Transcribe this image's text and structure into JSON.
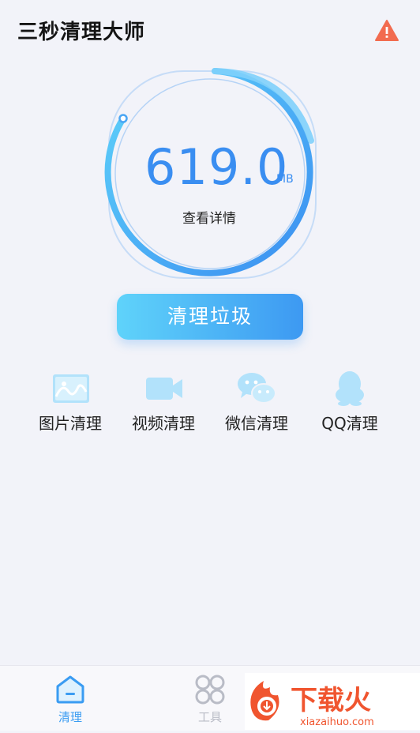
{
  "header": {
    "title": "三秒清理大师",
    "warning_icon": "warning-triangle-icon",
    "warning_color": "#f26b4f"
  },
  "gauge": {
    "value": "619.0",
    "unit": "MB",
    "detail_label": "查看详情",
    "arc_color_start": "#5fd3fa",
    "arc_color_end": "#3a8ef1"
  },
  "primary_action": {
    "label": "清理垃圾"
  },
  "features": [
    {
      "label": "图片清理",
      "icon": "image-icon"
    },
    {
      "label": "视频清理",
      "icon": "video-camera-icon"
    },
    {
      "label": "微信清理",
      "icon": "wechat-icon"
    },
    {
      "label": "QQ清理",
      "icon": "qq-penguin-icon"
    }
  ],
  "tabbar": {
    "items": [
      {
        "label": "清理",
        "icon": "home-icon",
        "active": true
      },
      {
        "label": "工具",
        "icon": "tools-grid-icon",
        "active": false
      }
    ],
    "active_color": "#3a9cf2",
    "inactive_color": "#b9bcc6"
  },
  "watermark": {
    "brand": "下载火",
    "domain": "xiazaihuo.com"
  }
}
